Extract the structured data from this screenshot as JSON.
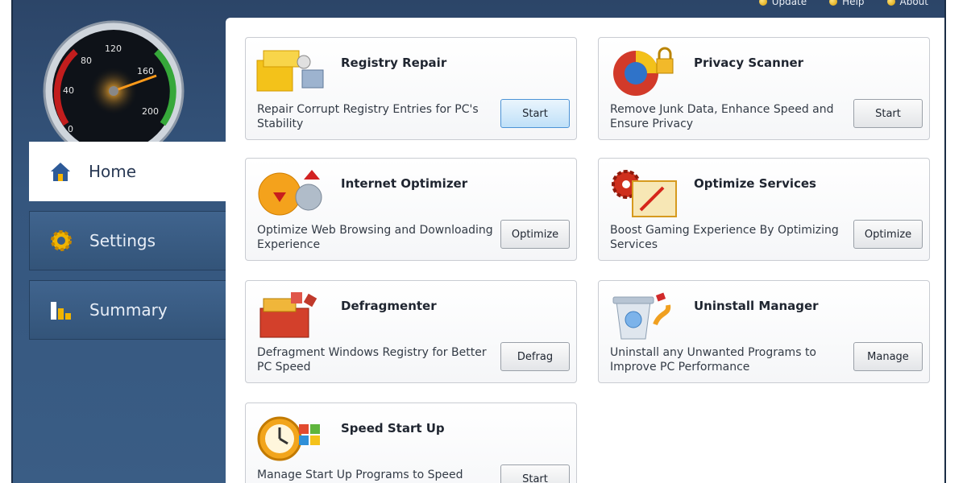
{
  "toolbar": {
    "links": [
      {
        "label": "Update",
        "icon": "update-icon"
      },
      {
        "label": "Help",
        "icon": "help-icon"
      },
      {
        "label": "About",
        "icon": "about-icon"
      }
    ]
  },
  "gauge": {
    "ticks": [
      "0",
      "40",
      "80",
      "120",
      "160",
      "200"
    ]
  },
  "nav": {
    "items": [
      {
        "label": "Home",
        "icon": "home-icon",
        "active": true
      },
      {
        "label": "Settings",
        "icon": "gear-icon",
        "active": false
      },
      {
        "label": "Summary",
        "icon": "bar-chart-icon",
        "active": false
      }
    ]
  },
  "cards": [
    {
      "title": "Registry Repair",
      "desc": "Repair Corrupt Registry Entries for PC's Stability",
      "button": "Start",
      "icon": "registry-icon"
    },
    {
      "title": "Privacy Scanner",
      "desc": "Remove Junk Data, Enhance Speed and Ensure Privacy",
      "button": "Start",
      "icon": "privacy-icon"
    },
    {
      "title": "Internet Optimizer",
      "desc": "Optimize Web Browsing and Downloading Experience",
      "button": "Optimize",
      "icon": "internet-icon"
    },
    {
      "title": "Optimize Services",
      "desc": "Boost Gaming Experience By Optimizing Services",
      "button": "Optimize",
      "icon": "services-icon"
    },
    {
      "title": "Defragmenter",
      "desc": "Defragment Windows Registry for Better PC Speed",
      "button": "Defrag",
      "icon": "defrag-icon"
    },
    {
      "title": "Uninstall Manager",
      "desc": "Uninstall any Unwanted Programs to Improve PC Performance",
      "button": "Manage",
      "icon": "recycle-bin-icon"
    },
    {
      "title": "Speed Start Up",
      "desc": "Manage Start Up Programs to Speed",
      "button": "Start",
      "icon": "clock-icon"
    }
  ]
}
